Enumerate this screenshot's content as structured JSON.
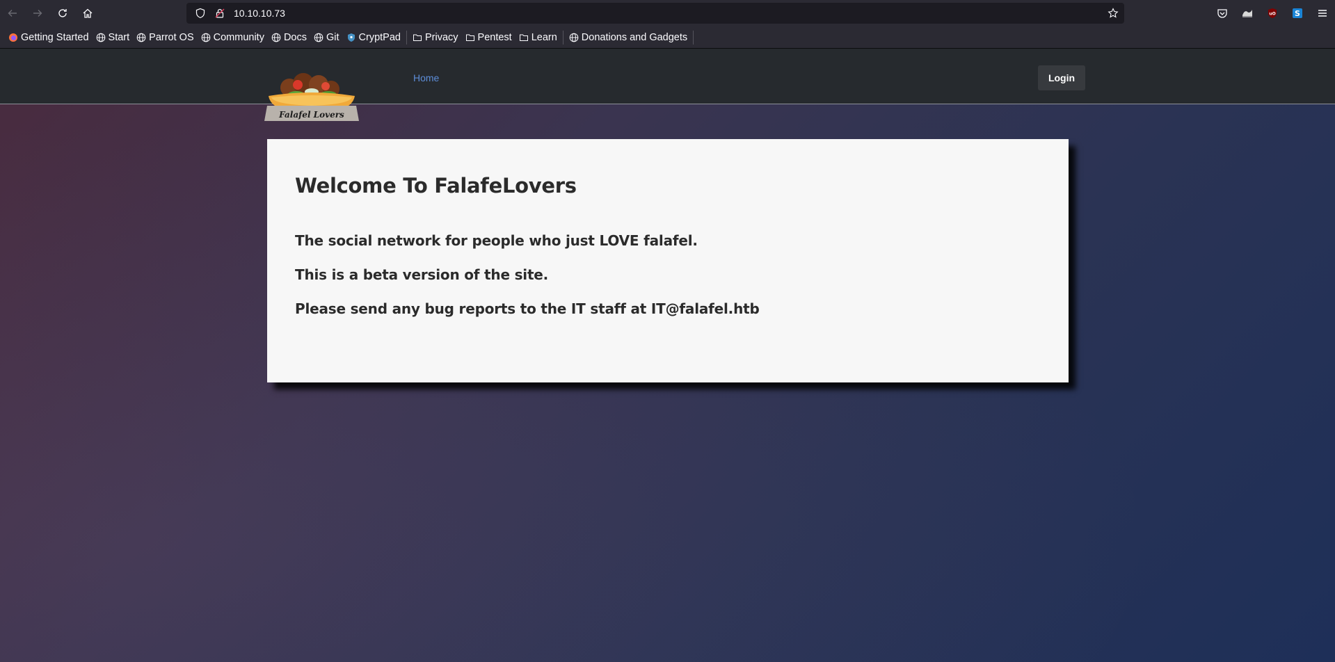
{
  "browser": {
    "url": "10.10.10.73",
    "icons": [
      "back-icon",
      "forward-icon",
      "reload-icon",
      "home-icon",
      "shield-icon",
      "lock-icon",
      "star-icon",
      "pocket-icon",
      "extension-icon",
      "ublock-icon",
      "s-extension-icon",
      "menu-icon"
    ]
  },
  "bookmarks": [
    {
      "label": "Getting Started",
      "icon": "firefox-icon"
    },
    {
      "label": "Start",
      "icon": "globe-icon"
    },
    {
      "label": "Parrot OS",
      "icon": "globe-icon"
    },
    {
      "label": "Community",
      "icon": "globe-icon"
    },
    {
      "label": "Docs",
      "icon": "globe-icon"
    },
    {
      "label": "Git",
      "icon": "globe-icon"
    },
    {
      "label": "CryptPad",
      "icon": "cryptpad-icon"
    },
    {
      "label": "Privacy",
      "icon": "folder-icon"
    },
    {
      "label": "Pentest",
      "icon": "folder-icon"
    },
    {
      "label": "Learn",
      "icon": "folder-icon"
    },
    {
      "label": "Donations and Gadgets",
      "icon": "globe-icon"
    }
  ],
  "site": {
    "logo_text": "Falafel Lovers",
    "nav_home": "Home",
    "login_label": "Login"
  },
  "card": {
    "heading": "Welcome To FalafeLovers",
    "line1": "The social network for people who just LOVE falafel.",
    "line2": "This is a beta version of the site.",
    "line3": "Please send any bug reports to the IT staff at IT@falafel.htb"
  },
  "colors": {
    "nav_bg": "#262a2e",
    "link": "#5d8dd8",
    "card_bg": "#f7f7f7",
    "login_bg": "#373a3e"
  }
}
